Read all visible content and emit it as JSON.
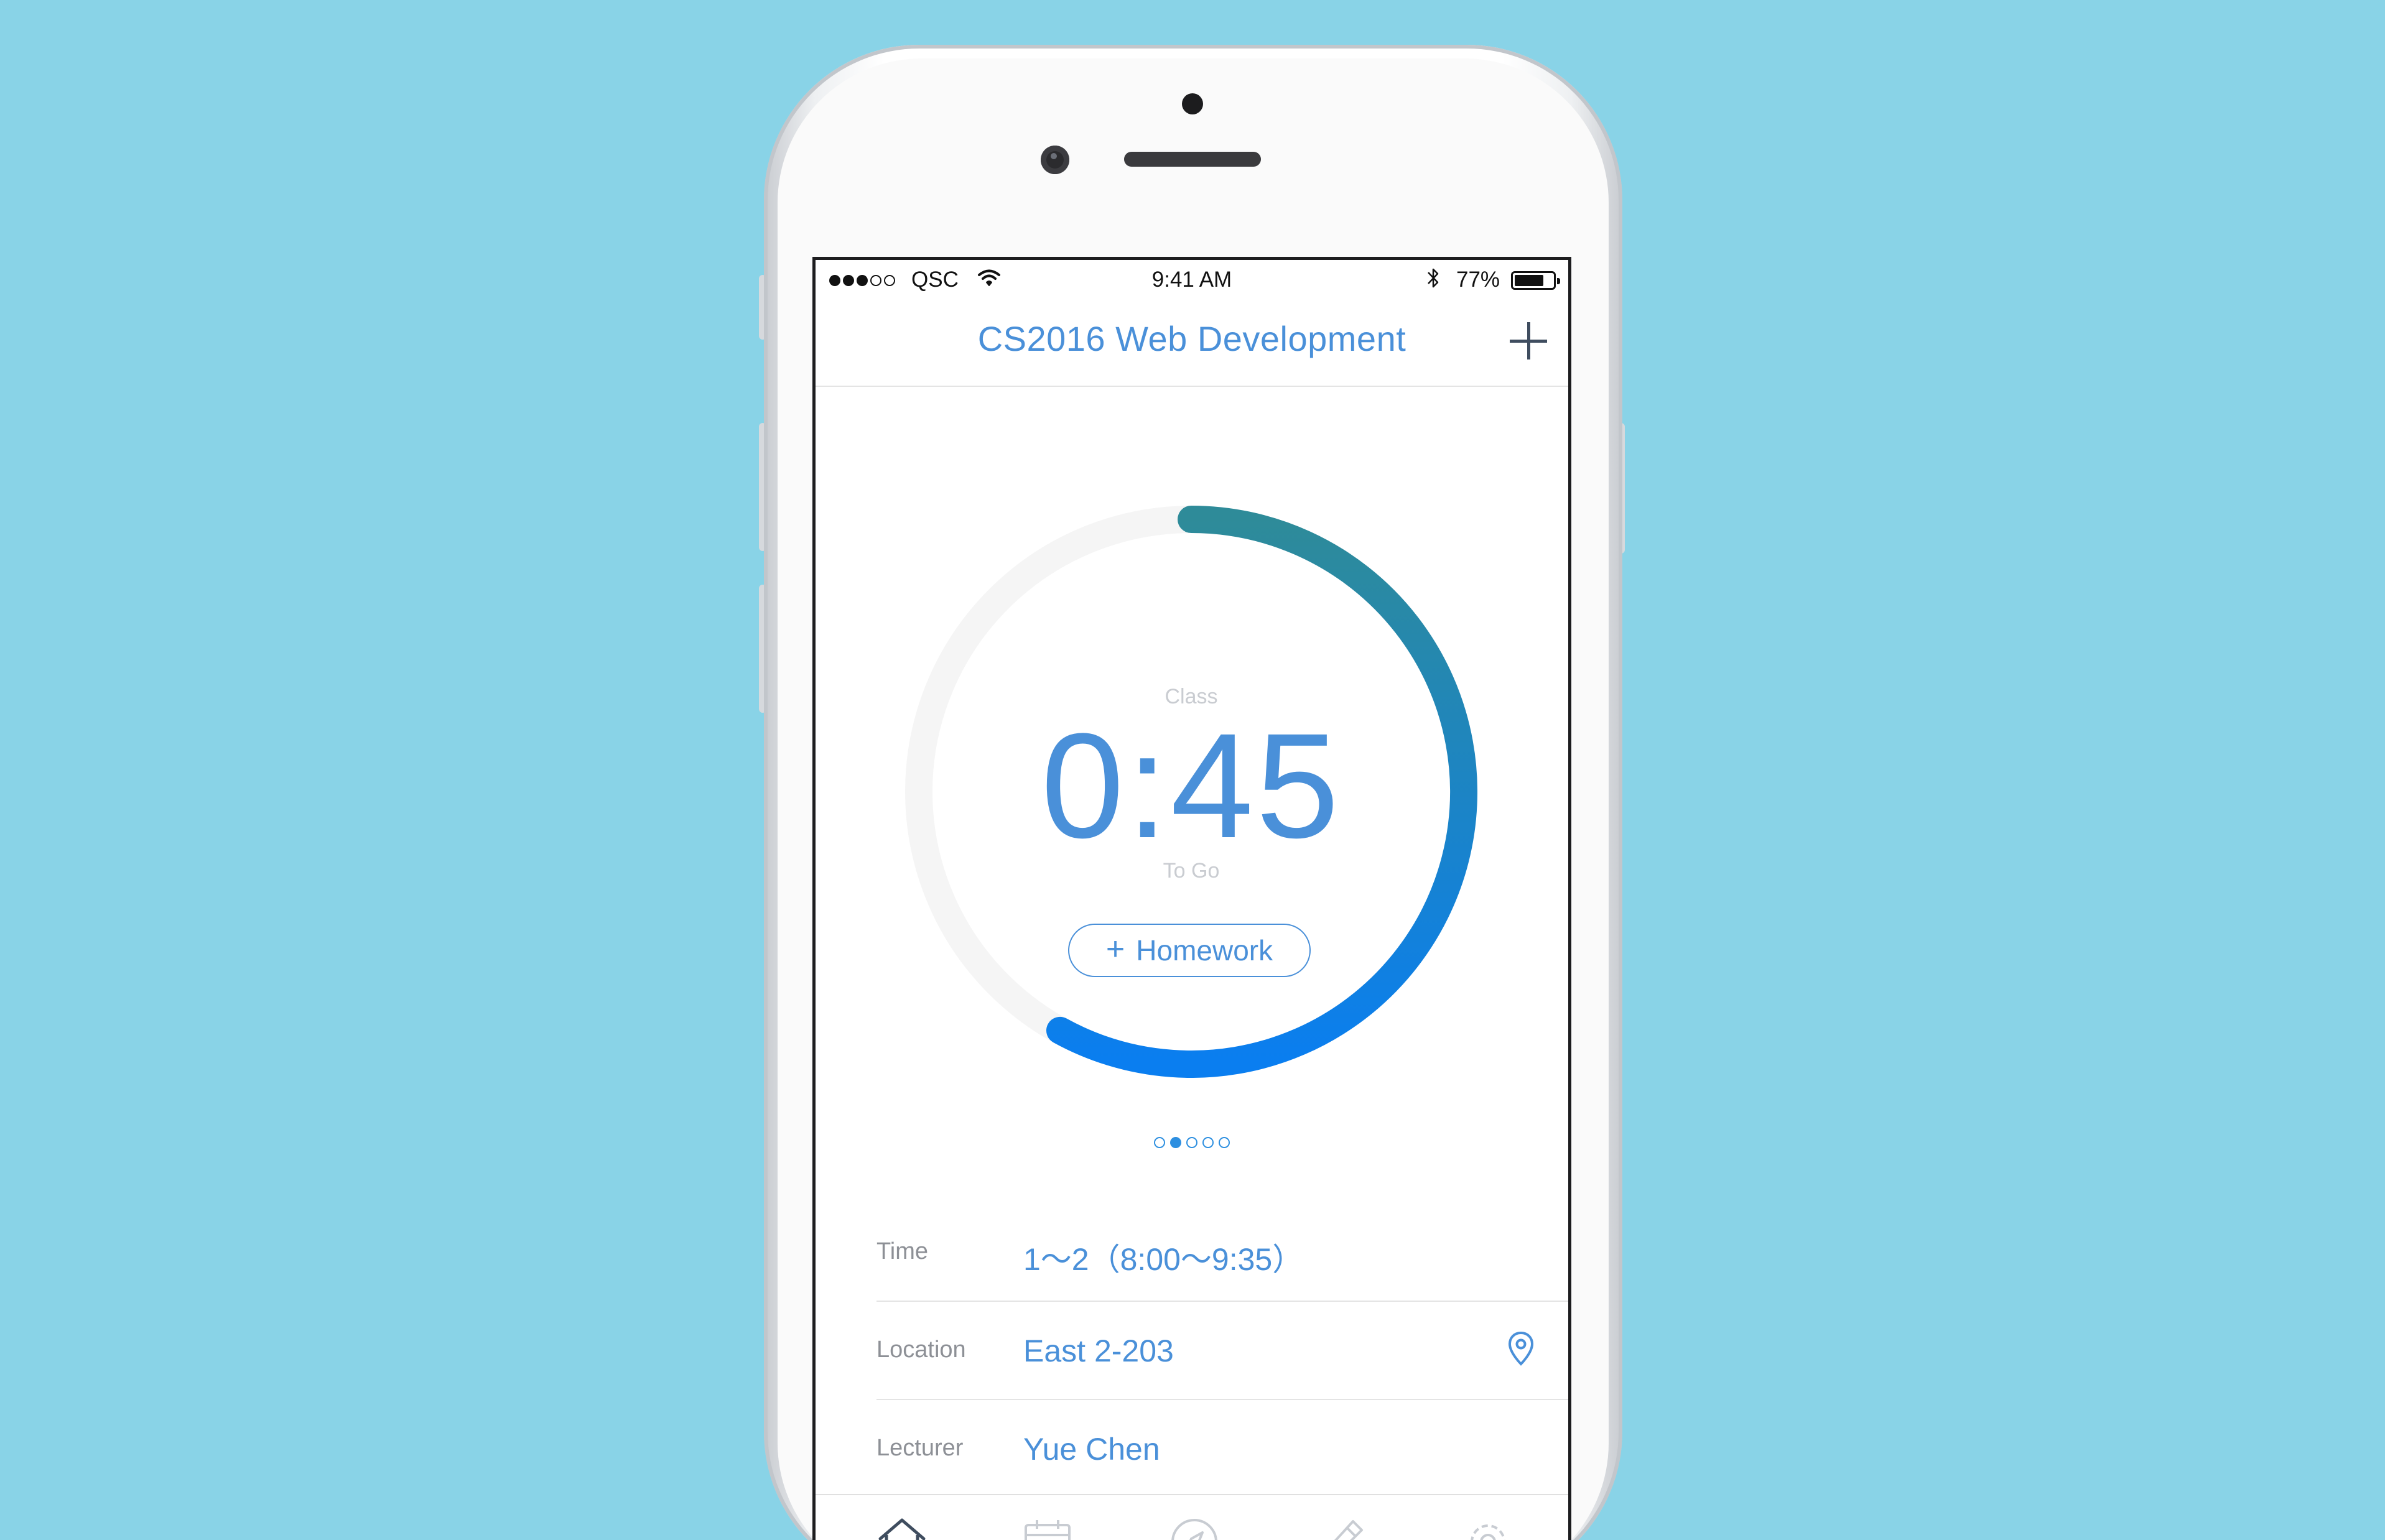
{
  "status_bar": {
    "signal_dots_filled": 3,
    "signal_dots_total": 5,
    "carrier": "QSC",
    "time": "9:41 AM",
    "battery_percent_text": "77%",
    "battery_level": 0.77
  },
  "nav": {
    "title": "CS2016 Web Development",
    "add_icon": "plus-icon"
  },
  "timer": {
    "label_top": "Class",
    "time": "0:45",
    "label_bottom": "To Go",
    "progress": 0.58,
    "gradient_start": "#2e8b99",
    "gradient_end": "#0a7ef0",
    "track_color": "#f5f5f5",
    "homework_button_icon": "+",
    "homework_button_label": "Homework"
  },
  "pager": {
    "count": 5,
    "active_index": 1
  },
  "details": [
    {
      "label": "Time",
      "value": "1～2（8:00～9:35）"
    },
    {
      "label": "Location",
      "value": "East 2-203",
      "icon": "location-pin-icon"
    },
    {
      "label": "Lecturer",
      "value": "Yue Chen"
    }
  ],
  "tab_bar": {
    "items": [
      "home-icon",
      "calendar-icon",
      "compass-icon",
      "pen-icon",
      "settings-icon"
    ],
    "active_index": 0
  },
  "colors": {
    "background": "#89d3e7",
    "accent": "#4a90d9",
    "label_gray": "#8d9096"
  }
}
